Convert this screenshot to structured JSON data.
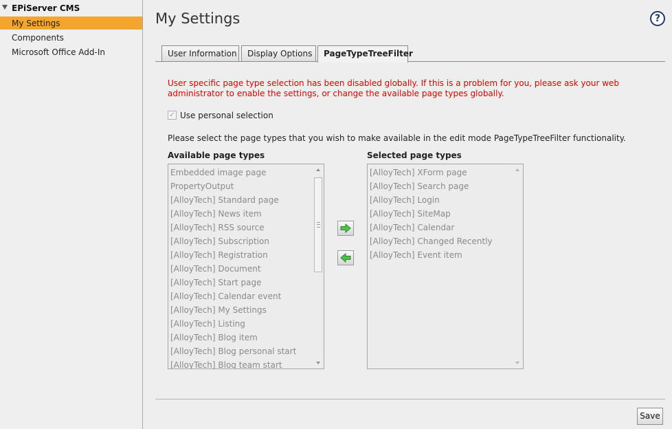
{
  "sidebar": {
    "root_label": "EPiServer CMS",
    "items": [
      {
        "label": "My Settings",
        "active": true
      },
      {
        "label": "Components",
        "active": false
      },
      {
        "label": "Microsoft Office Add-In",
        "active": false
      }
    ]
  },
  "header": {
    "title": "My Settings",
    "help_symbol": "?"
  },
  "tabs": [
    {
      "label": "User Information",
      "active": false
    },
    {
      "label": "Display Options",
      "active": false
    },
    {
      "label": "PageTypeTreeFilter",
      "active": true
    }
  ],
  "content": {
    "error_message": "User specific page type selection has been disabled globally. If this is a problem for you, please ask your web administrator to enable the settings, or change the available page types globally.",
    "checkbox_label": "Use personal selection",
    "checkbox_checked": true,
    "instruction": "Please select the page types that you wish to make available in the edit mode PageTypeTreeFilter functionality.",
    "available_title": "Available page types",
    "selected_title": "Selected page types",
    "available_items": [
      "Embedded image page",
      "PropertyOutput",
      "[AlloyTech] Standard page",
      "[AlloyTech] News item",
      "[AlloyTech] RSS source",
      "[AlloyTech] Subscription",
      "[AlloyTech] Registration",
      "[AlloyTech] Document",
      "[AlloyTech] Start page",
      "[AlloyTech] Calendar event",
      "[AlloyTech] My Settings",
      "[AlloyTech] Listing",
      "[AlloyTech] Blog item",
      "[AlloyTech] Blog personal start",
      "[AlloyTech] Blog team start"
    ],
    "selected_items": [
      "[AlloyTech] XForm page",
      "[AlloyTech] Search page",
      "[AlloyTech] Login",
      "[AlloyTech] SiteMap",
      "[AlloyTech] Calendar",
      "[AlloyTech] Changed Recently",
      "[AlloyTech] Event item"
    ]
  },
  "footer": {
    "save_label": "Save"
  },
  "colors": {
    "accent": "#f4a52e",
    "error": "#e00000",
    "arrow_green": "#3cb043"
  },
  "icons": {
    "tree_toggle": "chevron-down-icon",
    "help": "help-icon",
    "add": "arrow-right-icon",
    "remove": "arrow-left-icon"
  }
}
